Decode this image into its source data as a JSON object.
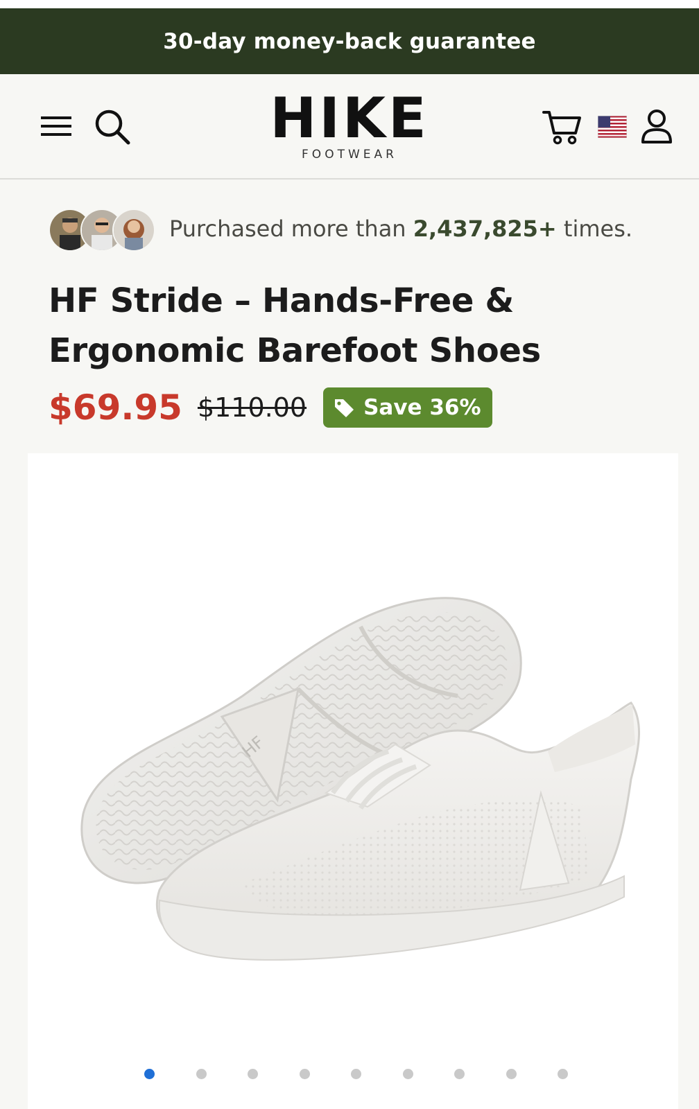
{
  "announcement": "30-day money-back guarantee",
  "header": {
    "logo_main": "HIKE",
    "logo_sub": "FOOTWEAR",
    "icons": [
      "menu-icon",
      "search-icon",
      "cart-icon",
      "us-flag-icon",
      "account-icon"
    ]
  },
  "social_proof": {
    "prefix": "Purchased more than",
    "count": "2,437,825+",
    "suffix": "times."
  },
  "product": {
    "title_line1": "HF Stride – Hands-Free &",
    "title_line2": "Ergonomic Barefoot Shoes",
    "price": "$69.95",
    "compare_price": "$110.00",
    "save_label": "Save 36%"
  },
  "gallery": {
    "image_count": 9,
    "active_index": 0
  },
  "colors": {
    "announcement_bg": "#2b3a21",
    "price": "#c8392b",
    "badge": "#5c8a2e",
    "active_dot": "#1f6fd6"
  }
}
